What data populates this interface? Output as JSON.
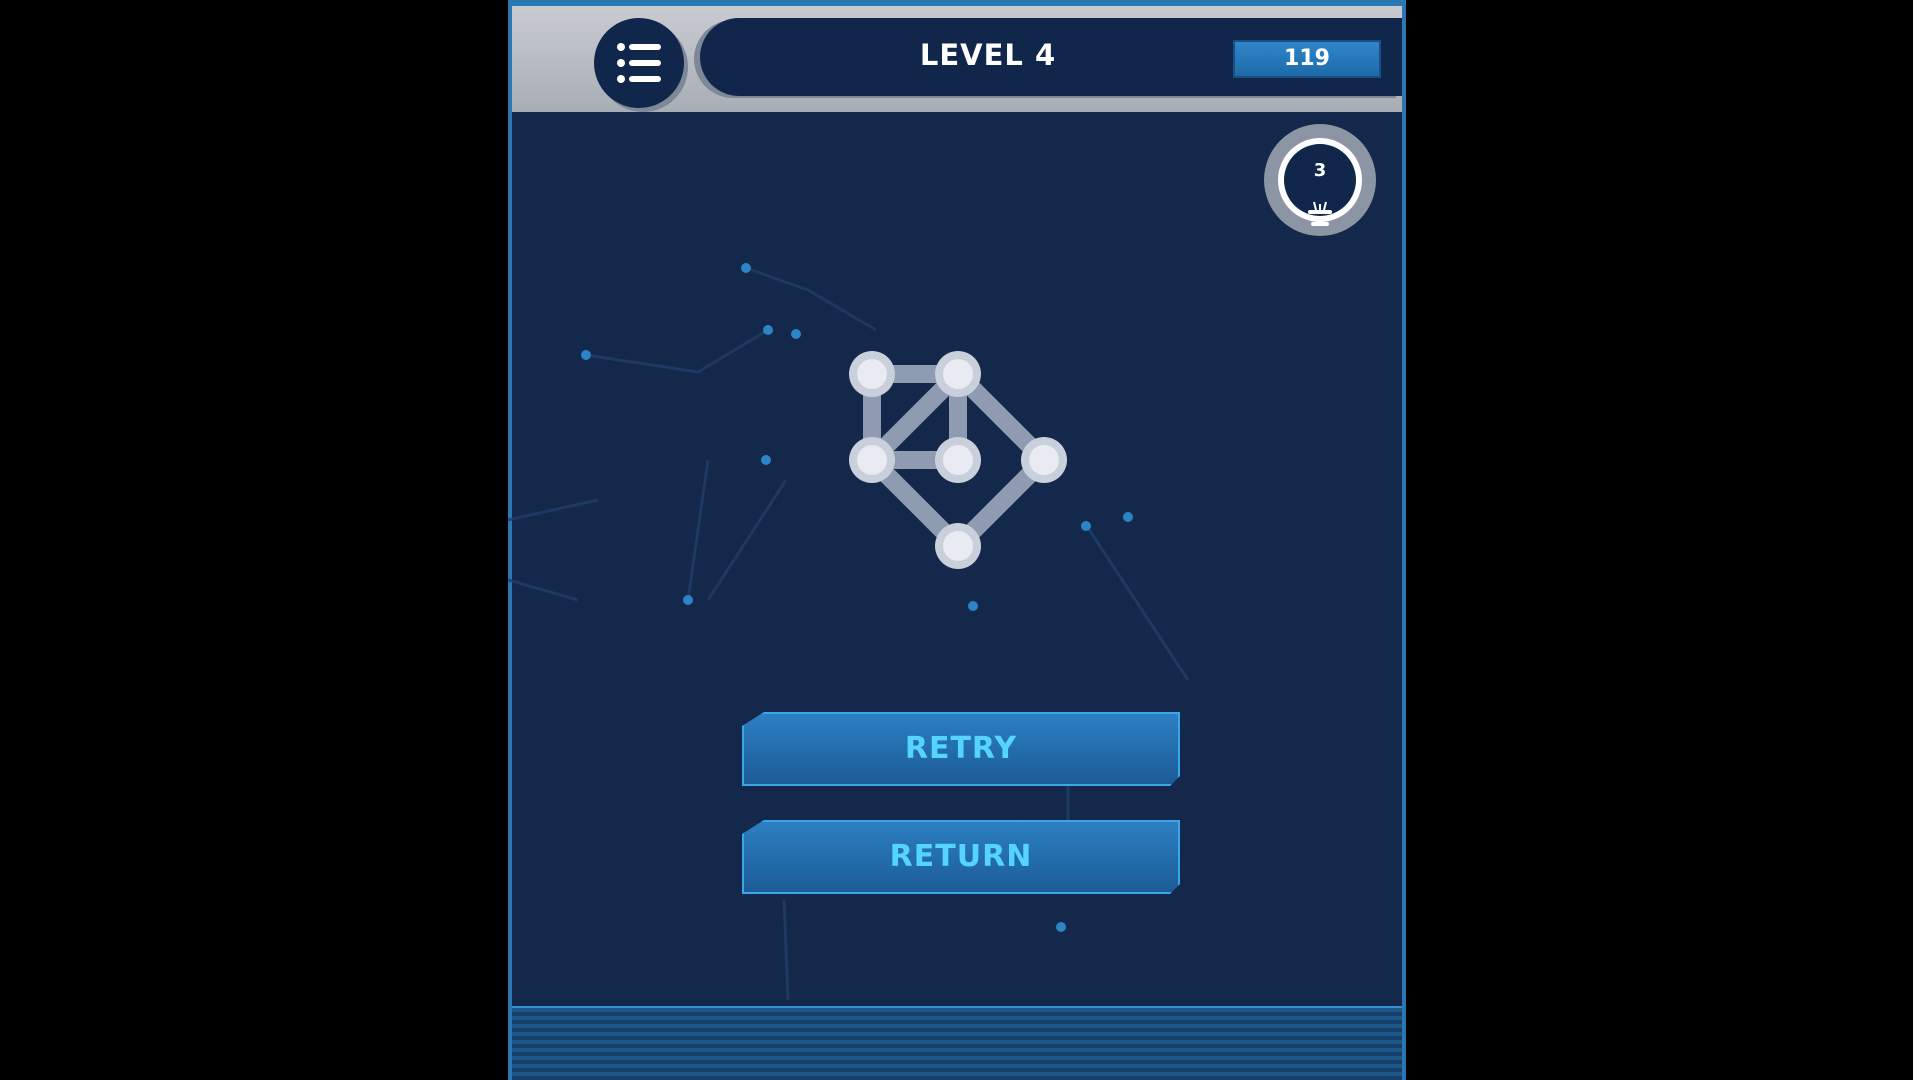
{
  "game": {
    "level_title": "LEVEL 4",
    "score": "119",
    "hints_remaining": "3",
    "buttons": {
      "retry": "RETRY",
      "return": "RETURN"
    }
  },
  "puzzle": {
    "nodes": [
      {
        "id": "a",
        "col": 0,
        "row": 0
      },
      {
        "id": "b",
        "col": 1,
        "row": 0
      },
      {
        "id": "c",
        "col": 0,
        "row": 1
      },
      {
        "id": "d",
        "col": 1,
        "row": 1
      },
      {
        "id": "e",
        "col": 2,
        "row": 1
      },
      {
        "id": "f",
        "col": 1,
        "row": 2
      }
    ],
    "edges": [
      [
        "a",
        "b"
      ],
      [
        "a",
        "c"
      ],
      [
        "b",
        "d"
      ],
      [
        "b",
        "c"
      ],
      [
        "c",
        "d"
      ],
      [
        "b",
        "e"
      ],
      [
        "e",
        "f"
      ],
      [
        "c",
        "f"
      ]
    ]
  },
  "icons": {
    "menu": "list-icon",
    "hint": "lightbulb-icon"
  },
  "colors": {
    "background": "#13284a",
    "frame_border": "#2a77b3",
    "button_text": "#55d4ff",
    "node": "#e8ecf2"
  }
}
